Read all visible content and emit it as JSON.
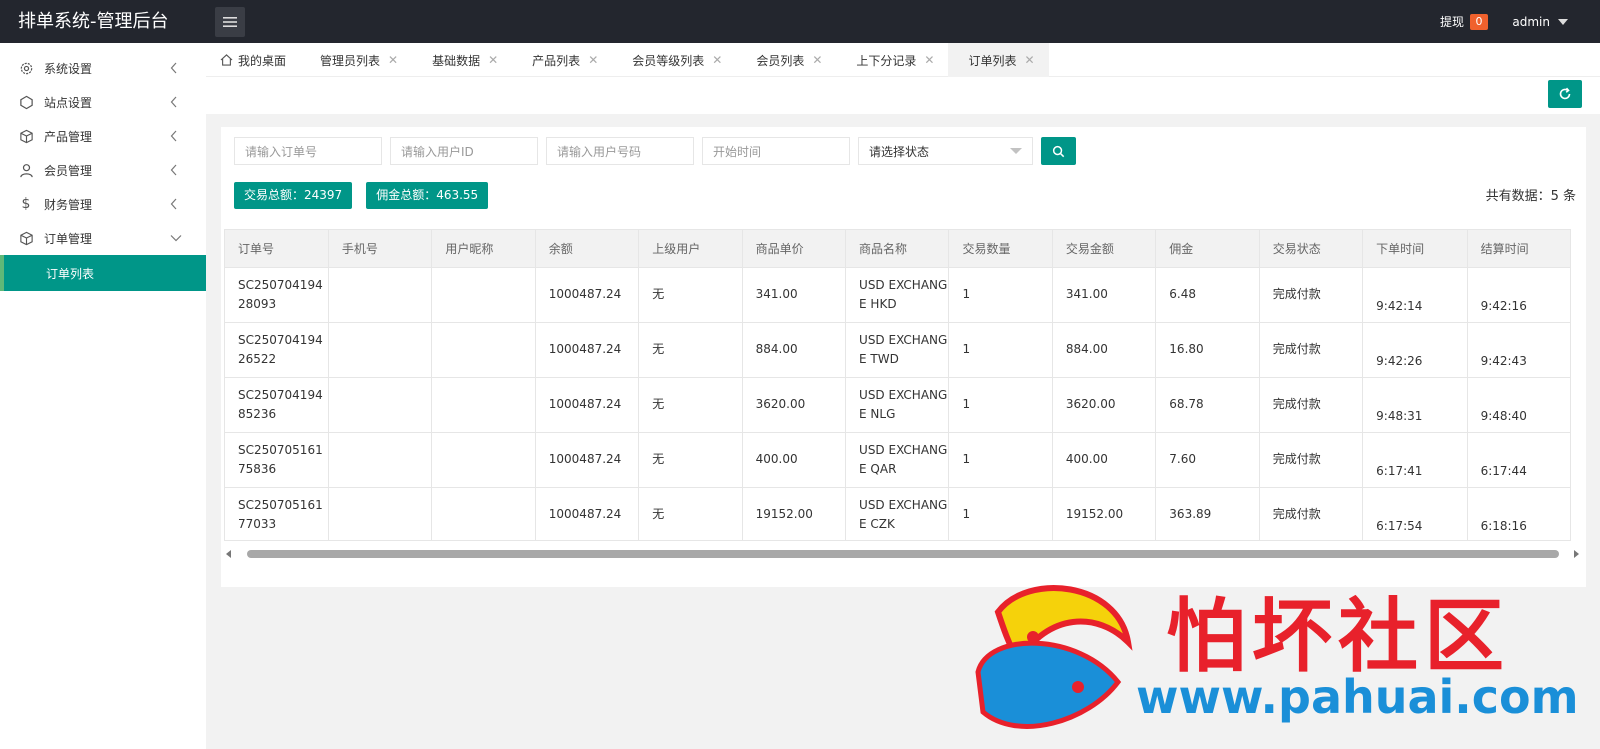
{
  "header": {
    "title": "排单系统-管理后台",
    "withdraw_label": "提现",
    "withdraw_count": "0",
    "user": "admin"
  },
  "sidebar": {
    "items": [
      {
        "label": "系统设置",
        "icon": "gear-icon"
      },
      {
        "label": "站点设置",
        "icon": "site-icon"
      },
      {
        "label": "产品管理",
        "icon": "box-icon"
      },
      {
        "label": "会员管理",
        "icon": "user-icon"
      },
      {
        "label": "财务管理",
        "icon": "dollar-icon"
      },
      {
        "label": "订单管理",
        "icon": "order-icon"
      }
    ],
    "active_sub": "订单列表"
  },
  "tabs": [
    {
      "label": "我的桌面"
    },
    {
      "label": "管理员列表"
    },
    {
      "label": "基础数据"
    },
    {
      "label": "产品列表"
    },
    {
      "label": "会员等级列表"
    },
    {
      "label": "会员列表"
    },
    {
      "label": "上下分记录"
    },
    {
      "label": "订单列表"
    }
  ],
  "filters": {
    "order_placeholder": "请输入订单号",
    "userid_placeholder": "请输入用户ID",
    "phone_placeholder": "请输入用户号码",
    "start_placeholder": "开始时间",
    "status_selected": "请选择状态"
  },
  "totals": {
    "trade_total": "交易总额：24397",
    "commission_total": "佣金总额：463.55"
  },
  "count_text": "共有数据：5 条",
  "table": {
    "headers": [
      "订单号",
      "手机号",
      "用户昵称",
      "余额",
      "上级用户",
      "商品单价",
      "商品名称",
      "交易数量",
      "交易金额",
      "佣金",
      "交易状态",
      "下单时间",
      "结算时间"
    ],
    "rows": [
      {
        "order": "SC25070419428093",
        "phone": "",
        "nick": "",
        "balance": "1000487.24",
        "parent": "无",
        "price": "341.00",
        "name": "USD EXCHANGE HKD",
        "qty": "1",
        "amount": "341.00",
        "commission": "6.48",
        "status": "完成付款",
        "order_time": "9:42:14",
        "settle_time": "9:42:16"
      },
      {
        "order": "SC25070419426522",
        "phone": "",
        "nick": "",
        "balance": "1000487.24",
        "parent": "无",
        "price": "884.00",
        "name": "USD EXCHANGE TWD",
        "qty": "1",
        "amount": "884.00",
        "commission": "16.80",
        "status": "完成付款",
        "order_time": "9:42:26",
        "settle_time": "9:42:43"
      },
      {
        "order": "SC25070419485236",
        "phone": "",
        "nick": "",
        "balance": "1000487.24",
        "parent": "无",
        "price": "3620.00",
        "name": "USD EXCHANGE NLG",
        "qty": "1",
        "amount": "3620.00",
        "commission": "68.78",
        "status": "完成付款",
        "order_time": "9:48:31",
        "settle_time": "9:48:40"
      },
      {
        "order": "SC25070516175836",
        "phone": "",
        "nick": "",
        "balance": "1000487.24",
        "parent": "无",
        "price": "400.00",
        "name": "USD EXCHANGE QAR",
        "qty": "1",
        "amount": "400.00",
        "commission": "7.60",
        "status": "完成付款",
        "order_time": "6:17:41",
        "settle_time": "6:17:44"
      },
      {
        "order": "SC25070516177033",
        "phone": "",
        "nick": "",
        "balance": "1000487.24",
        "parent": "无",
        "price": "19152.00",
        "name": "USD EXCHANGE CZK",
        "qty": "1",
        "amount": "19152.00",
        "commission": "363.89",
        "status": "完成付款",
        "order_time": "6:17:54",
        "settle_time": "6:18:16"
      }
    ]
  },
  "watermark": {
    "title": "怕坏社区",
    "url": "www.pahuai.com"
  },
  "colors": {
    "accent": "#009688",
    "header_bg": "#23262e",
    "badge": "#f0612d"
  }
}
